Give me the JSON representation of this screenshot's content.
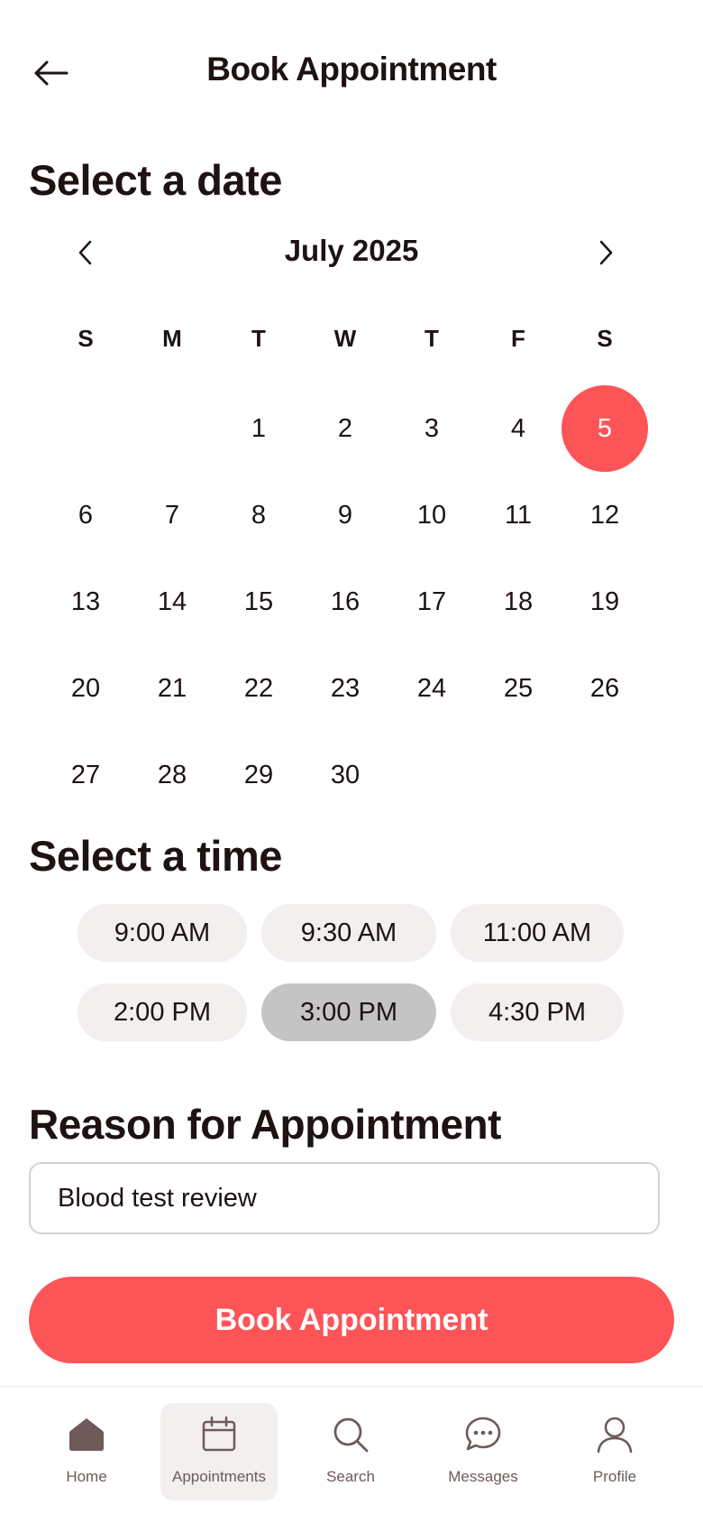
{
  "header": {
    "title": "Book Appointment",
    "back_icon": "arrow-left-icon"
  },
  "date_section": {
    "title": "Select a date",
    "month_label": "July 2025",
    "weekdays": [
      "S",
      "M",
      "T",
      "W",
      "T",
      "F",
      "S"
    ],
    "days": [
      "1",
      "2",
      "3",
      "4",
      "5",
      "6",
      "7",
      "8",
      "9",
      "10",
      "11",
      "12",
      "13",
      "14",
      "15",
      "16",
      "17",
      "18",
      "19",
      "20",
      "21",
      "22",
      "23",
      "24",
      "25",
      "26",
      "27",
      "28",
      "29",
      "30"
    ],
    "selected_day": "5"
  },
  "time_section": {
    "title": "Select a time",
    "slots": [
      "9:00 AM",
      "9:30 AM",
      "11:00 AM",
      "2:00 PM",
      "3:00 PM",
      "4:30 PM"
    ],
    "selected_slot": "3:00 PM"
  },
  "reason_section": {
    "title": "Reason for Appointment",
    "value": "Blood test review"
  },
  "book_button": {
    "label": "Book Appointment"
  },
  "bottom_nav": {
    "items": [
      {
        "label": "Home",
        "icon": "home-icon"
      },
      {
        "label": "Appointments",
        "icon": "calendar-icon",
        "active": true
      },
      {
        "label": "Search",
        "icon": "search-icon"
      },
      {
        "label": "Messages",
        "icon": "chat-bubble-icon"
      },
      {
        "label": "Profile",
        "icon": "user-icon"
      }
    ]
  },
  "colors": {
    "accent": "#fd5457",
    "text": "#1e1213",
    "pill": "#f2efee",
    "pill_selected": "#c4c4c4",
    "nav_icon": "#6e5a5a"
  }
}
